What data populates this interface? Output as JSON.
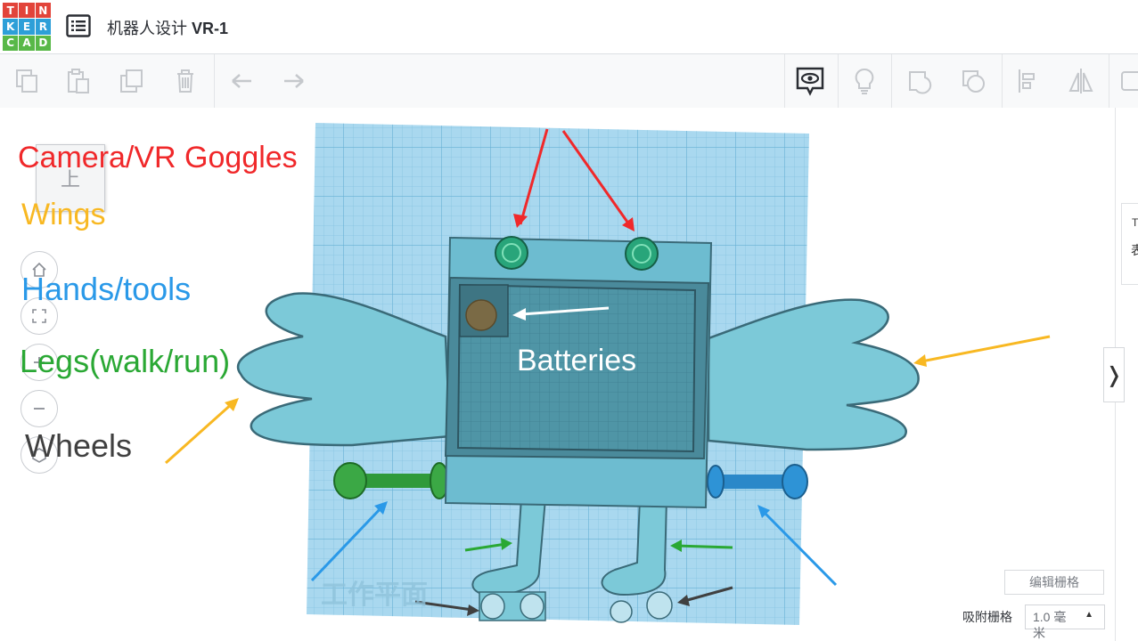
{
  "app": {
    "logo_letters": [
      "T",
      "I",
      "N",
      "K",
      "E",
      "R",
      "C",
      "A",
      "D"
    ],
    "logo_colors": [
      "#e2443a",
      "#e2443a",
      "#e2443a",
      "#2d9fd8",
      "#2d9fd8",
      "#2d9fd8",
      "#58b848",
      "#58b848",
      "#58b848"
    ],
    "title_cn": "机器人设计",
    "title_code": "VR-1"
  },
  "toolbar": {
    "left_icons": [
      "copy-icon",
      "paste-icon",
      "duplicate-icon",
      "delete-icon",
      "undo-icon",
      "redo-icon"
    ],
    "right_icons": [
      "notes-toggle-icon",
      "lightbulb-icon",
      "shape-group-icon",
      "shape-ungroup-icon",
      "align-icon",
      "mirror-icon"
    ]
  },
  "viewcube": {
    "face_label": "上"
  },
  "nav_icons": [
    "home-icon",
    "fit-view-icon",
    "zoom-in-icon",
    "zoom-out-icon",
    "perspective-icon"
  ],
  "annotations": {
    "camera": {
      "text": "Camera/VR Goggles",
      "color": "#f0282a"
    },
    "wings": {
      "text": "Wings",
      "color": "#f8b822"
    },
    "hands": {
      "text": "Hands/tools",
      "color": "#2a99e8"
    },
    "legs": {
      "text": "Legs(walk/run)",
      "color": "#2aa834"
    },
    "wheels": {
      "text": "Wheels",
      "color": "#404040"
    },
    "batteries": {
      "text": "Batteries",
      "color": "#ffffff"
    }
  },
  "workplane": {
    "watermark": "工作平面"
  },
  "grid_controls": {
    "edit_grid_label": "编辑栅格",
    "snap_label": "吸附栅格",
    "snap_value": "1.0 毫米"
  },
  "right_panel": {
    "collapse_glyph": "❭",
    "peek_line1": "T",
    "peek_line2": "表"
  }
}
